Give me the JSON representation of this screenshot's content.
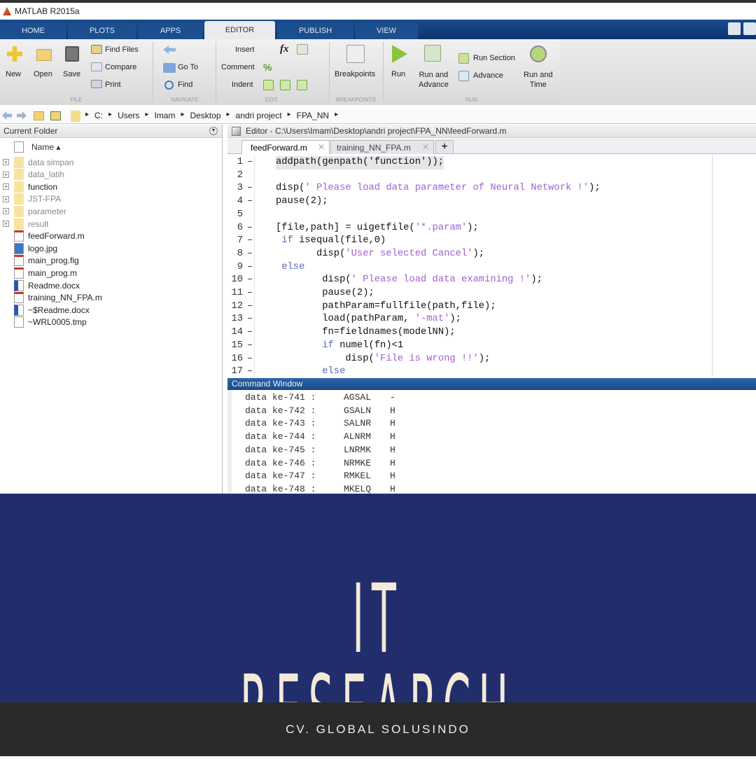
{
  "app": {
    "title": "MATLAB R2015a"
  },
  "tabs": [
    {
      "label": "HOME"
    },
    {
      "label": "PLOTS"
    },
    {
      "label": "APPS"
    },
    {
      "label": "EDITOR",
      "active": true
    },
    {
      "label": "PUBLISH"
    },
    {
      "label": "VIEW"
    }
  ],
  "ribbon": {
    "file": {
      "new": "New",
      "open": "Open",
      "save": "Save",
      "find_files": "Find Files",
      "compare": "Compare",
      "print": "Print",
      "section": "FILE"
    },
    "navigate": {
      "go_to": "Go To",
      "find": "Find",
      "section": "NAVIGATE"
    },
    "edit": {
      "insert": "Insert",
      "comment": "Comment",
      "indent": "Indent",
      "section": "EDIT"
    },
    "breakpoints": {
      "label": "Breakpoints",
      "section": "BREAKPOINTS"
    },
    "run": {
      "run": "Run",
      "run_and_advance_1": "Run and",
      "run_and_advance_2": "Advance",
      "run_section": "Run Section",
      "advance": "Advance",
      "run_and_time_1": "Run and",
      "run_and_time_2": "Time",
      "section": "RUN"
    }
  },
  "address": {
    "path": [
      "C:",
      "Users",
      "Imam",
      "Desktop",
      "andri project",
      "FPA_NN"
    ]
  },
  "folder": {
    "title": "Current Folder",
    "column": "Name ▴",
    "items": [
      {
        "name": "data simpan",
        "type": "folder",
        "dim": true
      },
      {
        "name": "data_latih",
        "type": "folder",
        "dim": true
      },
      {
        "name": "function",
        "type": "folder",
        "dim": false
      },
      {
        "name": "JST-FPA",
        "type": "folder",
        "dim": true
      },
      {
        "name": "parameter",
        "type": "folder",
        "dim": true
      },
      {
        "name": "result",
        "type": "folder",
        "dim": true
      },
      {
        "name": "feedForward.m",
        "type": "mfile"
      },
      {
        "name": "logo.jpg",
        "type": "image"
      },
      {
        "name": "main_prog.fig",
        "type": "mfile"
      },
      {
        "name": "main_prog.m",
        "type": "mfile"
      },
      {
        "name": "Readme.docx",
        "type": "word"
      },
      {
        "name": "training_NN_FPA.m",
        "type": "mfile"
      },
      {
        "name": "~$Readme.docx",
        "type": "word"
      },
      {
        "name": "~WRL0005.tmp",
        "type": "file"
      }
    ]
  },
  "editor": {
    "title": "Editor - C:\\Users\\Imam\\Desktop\\andri project\\FPA_NN\\feedForward.m",
    "tabs": [
      {
        "label": "feedForward.m",
        "active": true
      },
      {
        "label": "training_NN_FPA.m"
      }
    ],
    "lines": [
      {
        "n": "1",
        "d": "–",
        "segs": [
          [
            "addpath(genpath('function'));",
            ""
          ]
        ]
      },
      {
        "n": "2",
        "d": "",
        "segs": []
      },
      {
        "n": "3",
        "d": "–",
        "segs": [
          [
            "disp(",
            ""
          ],
          [
            "' Please load data parameter of Neural Network !'",
            "str"
          ],
          [
            ");",
            ""
          ]
        ]
      },
      {
        "n": "4",
        "d": "–",
        "segs": [
          [
            "pause(2);",
            ""
          ]
        ]
      },
      {
        "n": "5",
        "d": "",
        "segs": []
      },
      {
        "n": "6",
        "d": "–",
        "segs": [
          [
            "[file,path] = uigetfile(",
            ""
          ],
          [
            "'*.param'",
            "str"
          ],
          [
            ");",
            ""
          ]
        ]
      },
      {
        "n": "7",
        "d": "–",
        "segs": [
          [
            " ",
            ""
          ],
          [
            "if",
            "kw"
          ],
          [
            " isequal(file,0)",
            ""
          ]
        ]
      },
      {
        "n": "8",
        "d": "–",
        "segs": [
          [
            "       disp(",
            ""
          ],
          [
            "'User selected Cancel'",
            "str"
          ],
          [
            ");",
            ""
          ]
        ]
      },
      {
        "n": "9",
        "d": "–",
        "segs": [
          [
            " ",
            ""
          ],
          [
            "else",
            "kw"
          ]
        ]
      },
      {
        "n": "10",
        "d": "–",
        "segs": [
          [
            "        disp(",
            ""
          ],
          [
            "' Please load data examining !'",
            "str"
          ],
          [
            ");",
            ""
          ]
        ]
      },
      {
        "n": "11",
        "d": "–",
        "segs": [
          [
            "        pause(2);",
            ""
          ]
        ]
      },
      {
        "n": "12",
        "d": "–",
        "segs": [
          [
            "        pathParam=fullfile(path,file);",
            ""
          ]
        ]
      },
      {
        "n": "13",
        "d": "–",
        "segs": [
          [
            "        load(pathParam, ",
            ""
          ],
          [
            "'-mat'",
            "str"
          ],
          [
            ");",
            ""
          ]
        ]
      },
      {
        "n": "14",
        "d": "–",
        "segs": [
          [
            "        fn=fieldnames(modelNN);",
            ""
          ]
        ]
      },
      {
        "n": "15",
        "d": "–",
        "segs": [
          [
            "        ",
            ""
          ],
          [
            "if",
            "kw"
          ],
          [
            " numel(fn)<1",
            ""
          ]
        ]
      },
      {
        "n": "16",
        "d": "–",
        "segs": [
          [
            "            disp(",
            ""
          ],
          [
            "'File is wrong !!'",
            "str"
          ],
          [
            ");",
            ""
          ]
        ]
      },
      {
        "n": "17",
        "d": "–",
        "segs": [
          [
            "        ",
            ""
          ],
          [
            "else",
            "kw"
          ]
        ]
      }
    ]
  },
  "command_window": {
    "title": "Command Window",
    "rows": [
      {
        "label": "data ke-741 :",
        "seq": "AGSAL",
        "cls": "-"
      },
      {
        "label": "data ke-742 :",
        "seq": "GSALN",
        "cls": "H"
      },
      {
        "label": "data ke-743 :",
        "seq": "SALNR",
        "cls": "H"
      },
      {
        "label": "data ke-744 :",
        "seq": "ALNRM",
        "cls": "H"
      },
      {
        "label": "data ke-745 :",
        "seq": "LNRMK",
        "cls": "H"
      },
      {
        "label": "data ke-746 :",
        "seq": "NRMKE",
        "cls": "H"
      },
      {
        "label": "data ke-747 :",
        "seq": "RMKEL",
        "cls": "H"
      },
      {
        "label": "data ke-748 :",
        "seq": "MKELQ",
        "cls": "H"
      }
    ]
  },
  "banner": {
    "title": "IT RESEARCH",
    "bg": "#222e6c"
  },
  "footer": {
    "text": "CV. GLOBAL SOLUSINDO"
  }
}
